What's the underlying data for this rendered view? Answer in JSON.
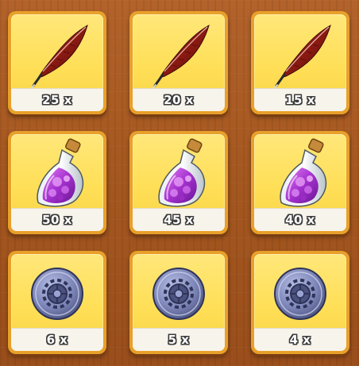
{
  "rewards": [
    {
      "item": "feather-icon",
      "quantity": "25 x"
    },
    {
      "item": "feather-icon",
      "quantity": "20 x"
    },
    {
      "item": "feather-icon",
      "quantity": "15 x"
    },
    {
      "item": "potion-icon",
      "quantity": "50 x"
    },
    {
      "item": "potion-icon",
      "quantity": "45 x"
    },
    {
      "item": "potion-icon",
      "quantity": "40 x"
    },
    {
      "item": "gear-coin-icon",
      "quantity": "6 x"
    },
    {
      "item": "gear-coin-icon",
      "quantity": "5 x"
    },
    {
      "item": "gear-coin-icon",
      "quantity": "4 x"
    }
  ],
  "colors": {
    "background_wood": "#a4571f",
    "card_border": "#e8a02a",
    "card_fill": "#ffdf57",
    "strip": "#f7f4ec",
    "feather": "#8b1a12",
    "potion_liquid": "#b03cd6",
    "coin": "#7d86b8"
  }
}
